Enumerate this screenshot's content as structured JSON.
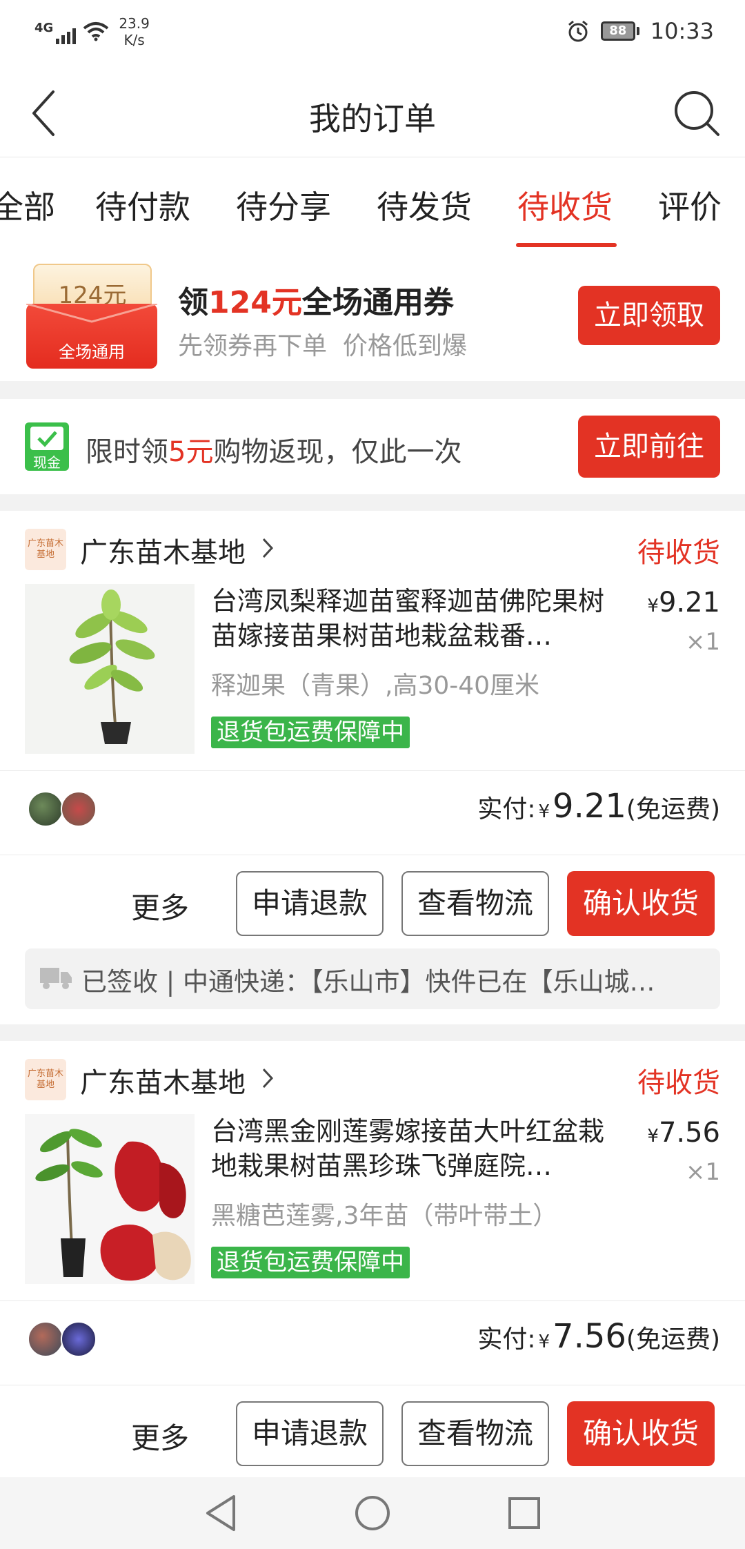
{
  "status_bar": {
    "network": "4G",
    "speed_value": "23.9",
    "speed_unit": "K/s",
    "battery": "88",
    "time": "10:33"
  },
  "header": {
    "title": "我的订单"
  },
  "tabs": [
    {
      "label": "全部"
    },
    {
      "label": "待付款"
    },
    {
      "label": "待分享"
    },
    {
      "label": "待发货"
    },
    {
      "label": "待收货",
      "active": true
    },
    {
      "label": "评价"
    }
  ],
  "coupon": {
    "ticket_amount": "124元",
    "ticket_label": "全场通用",
    "title_prefix": "领",
    "title_amount": "124元",
    "title_suffix": "全场通用券",
    "subtitle": "先领券再下单  价格低到爆",
    "button": "立即领取"
  },
  "cashback": {
    "icon_label": "现金",
    "text_prefix": "限时领",
    "text_amount": "5元",
    "text_suffix": "购物返现，仅此一次",
    "button": "立即前往"
  },
  "orders": [
    {
      "shop_logo_text": "广东苗木基地",
      "shop_name": "广东苗木基地",
      "status": "待收货",
      "product_title": "台湾凤梨释迦苗蜜释迦苗佛陀果树苗嫁接苗果树苗地栽盆栽番…",
      "price_symbol": "¥",
      "price": "9.21",
      "quantity": "×1",
      "spec": "释迦果（青果）,高30-40厘米",
      "guarantee": "退货包运费保障中",
      "paid_label": "实付:",
      "paid_symbol": "¥",
      "paid_amount": "9.21",
      "shipping_note": "(免运费)",
      "more": "更多",
      "refund_button": "申请退款",
      "logistics_button": "查看物流",
      "confirm_button": "确认收货",
      "logistics_text": "已签收 | 中通快递：【乐山市】快件已在【乐山城…"
    },
    {
      "shop_logo_text": "广东苗木基地",
      "shop_name": "广东苗木基地",
      "status": "待收货",
      "product_title": "台湾黑金刚莲雾嫁接苗大叶红盆栽地栽果树苗黑珍珠飞弹庭院…",
      "price_symbol": "¥",
      "price": "7.56",
      "quantity": "×1",
      "spec": "黑糖芭莲雾,3年苗（带叶带土）",
      "guarantee": "退货包运费保障中",
      "paid_label": "实付:",
      "paid_symbol": "¥",
      "paid_amount": "7.56",
      "shipping_note": "(免运费)",
      "more": "更多",
      "refund_button": "申请退款",
      "logistics_button": "查看物流",
      "confirm_button": "确认收货"
    }
  ],
  "colors": {
    "accent": "#e33324",
    "guarantee": "#3bb54a",
    "background": "#f2f2f2"
  }
}
